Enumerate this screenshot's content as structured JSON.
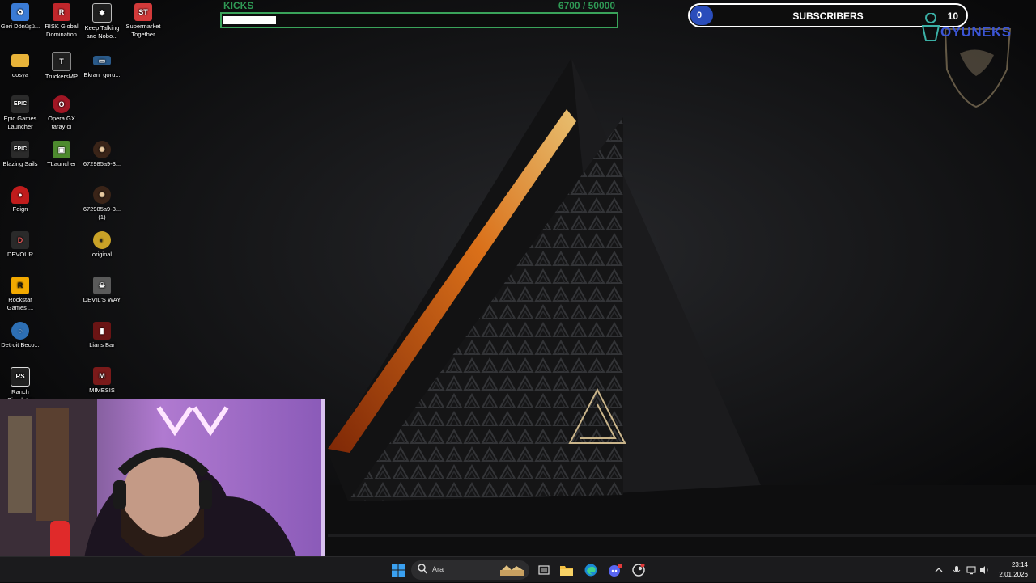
{
  "overlay": {
    "kicks": {
      "label": "KICKS",
      "current": "6700",
      "goal": "/ 50000",
      "progress": 0.134
    },
    "subscribers": {
      "count": "0",
      "label": "SUBSCRIBERS",
      "goal": "10"
    },
    "brand": {
      "text": "OYUNEKS"
    }
  },
  "desktop_icons": [
    {
      "label": "Geri Dönüşü...",
      "icon": "recycle-bin-icon",
      "color": "#3a7bd5",
      "glyph": "♻"
    },
    {
      "label": "RISK Global Domination",
      "icon": "risk-game-icon",
      "color": "#c0262b",
      "glyph": "R"
    },
    {
      "label": "Keep Talking and Nobo...",
      "icon": "bomb-game-icon",
      "color": "#1f1f1f",
      "glyph": "✱"
    },
    {
      "label": "Supermarket Together",
      "icon": "supermarket-game-icon",
      "color": "#d23a3a",
      "glyph": "ST"
    },
    {
      "label": "dosya",
      "icon": "folder-icon",
      "color": "#e8b339",
      "glyph": ""
    },
    {
      "label": "TruckersMP",
      "icon": "truckersmp-icon",
      "color": "#202020",
      "glyph": "T"
    },
    {
      "label": "Ekran_goru...",
      "icon": "screenshot-file-icon",
      "color": "#2a5a8a",
      "glyph": "▭"
    },
    {
      "label": "Epic Games Launcher",
      "icon": "epic-games-icon",
      "color": "#2b2b2b",
      "glyph": "EPIC"
    },
    {
      "label": "Opera GX tarayıcı",
      "icon": "opera-gx-icon",
      "color": "#a01624",
      "glyph": "O"
    },
    {
      "label": "Blazing Sails",
      "icon": "epic-games-icon",
      "color": "#2b2b2b",
      "glyph": "EPIC"
    },
    {
      "label": "TLauncher",
      "icon": "tlauncher-icon",
      "color": "#4d8a2e",
      "glyph": "▣"
    },
    {
      "label": "672985a9-3...",
      "icon": "game-shortcut-icon",
      "color": "#3a2418",
      "glyph": "✺"
    },
    {
      "label": "Feign",
      "icon": "feign-game-icon",
      "color": "#c01c1c",
      "glyph": "●"
    },
    {
      "label": "672985a9-3... (1)",
      "icon": "game-shortcut-icon",
      "color": "#3a2418",
      "glyph": "✺"
    },
    {
      "label": "DEVOUR",
      "icon": "devour-game-icon",
      "color": "#2a2a2a",
      "glyph": "D"
    },
    {
      "label": "original",
      "icon": "original-game-icon",
      "color": "#c9a227",
      "glyph": "◐"
    },
    {
      "label": "Rockstar Games ...",
      "icon": "rockstar-games-icon",
      "color": "#f2a900",
      "glyph": "R"
    },
    {
      "label": "DEVIL'S WAY",
      "icon": "devils-way-icon",
      "color": "#5a5a5a",
      "glyph": "☠"
    },
    {
      "label": "Detroit Beco...",
      "icon": "detroit-game-icon",
      "color": "#2d6fb4",
      "glyph": "◌"
    },
    {
      "label": "Liar's Bar",
      "icon": "liars-bar-icon",
      "color": "#6a1414",
      "glyph": "▮"
    },
    {
      "label": "Ranch Simulator",
      "icon": "ranch-simulator-icon",
      "color": "#222",
      "glyph": "RS"
    },
    {
      "label": "MIMESIS",
      "icon": "mimesis-icon",
      "color": "#7a1a1a",
      "glyph": "M"
    }
  ],
  "taskbar": {
    "search_placeholder": "Ara",
    "clock_time": "23:14",
    "clock_date": "2.01.2026"
  }
}
